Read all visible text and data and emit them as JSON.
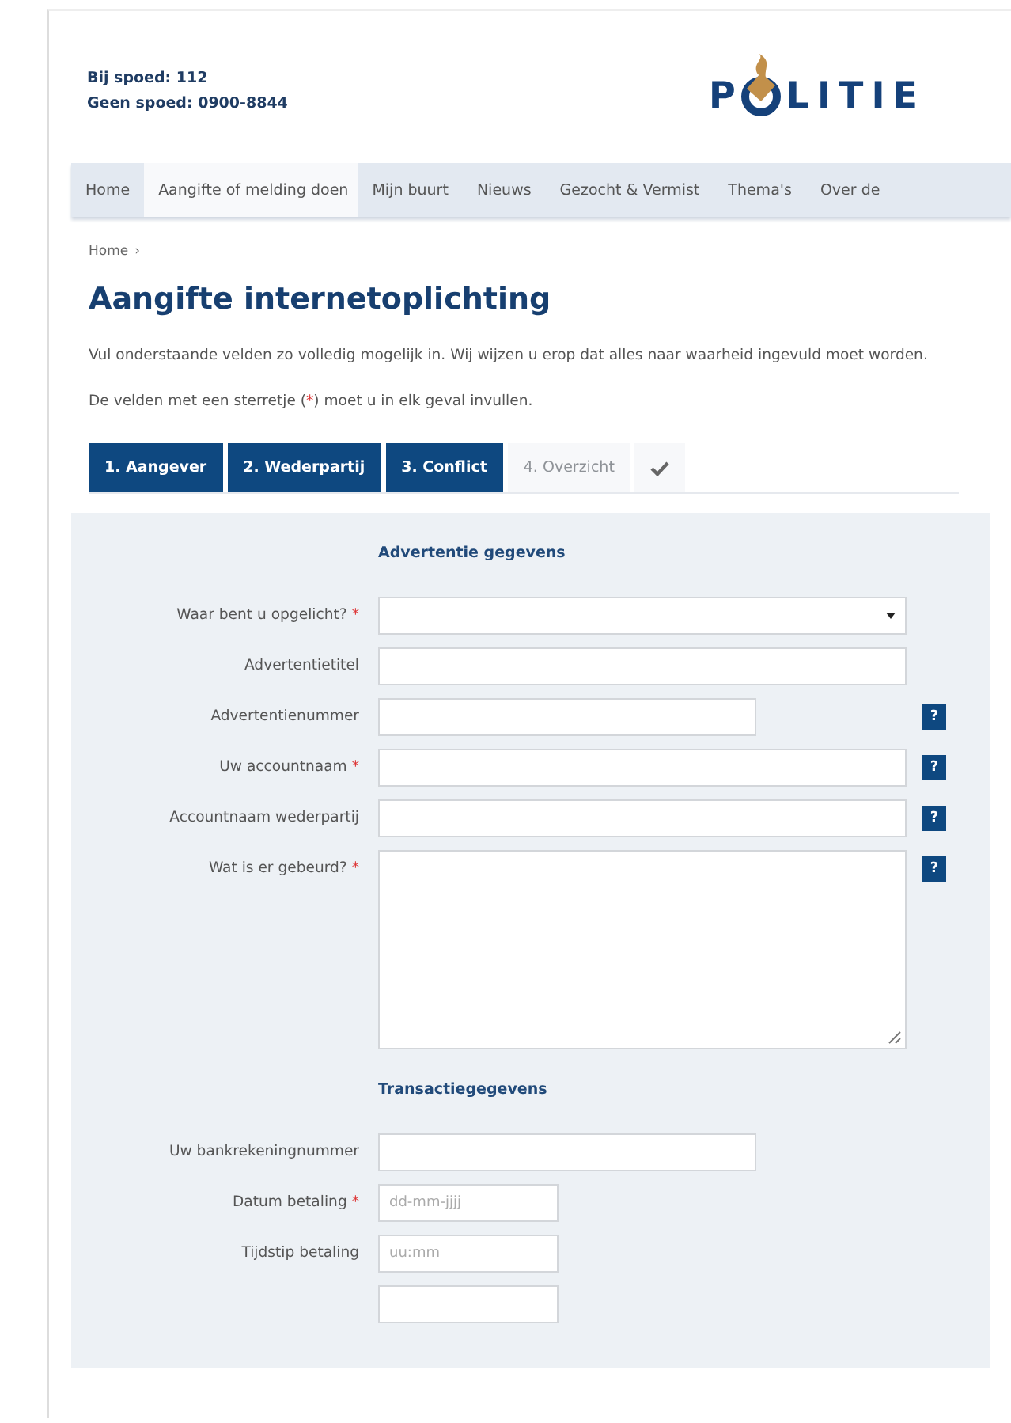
{
  "header": {
    "contact": [
      "Bij spoed: 112",
      "Geen spoed: 0900-8844"
    ],
    "logo": {
      "before": "P",
      "after": "LITIE"
    }
  },
  "nav": [
    {
      "label": "Home",
      "selected": false
    },
    {
      "label": "Aangifte of melding doen",
      "selected": true
    },
    {
      "label": "Mijn buurt",
      "selected": false
    },
    {
      "label": "Nieuws",
      "selected": false
    },
    {
      "label": "Gezocht & Vermist",
      "selected": false
    },
    {
      "label": "Thema's",
      "selected": false
    },
    {
      "label": "Over de",
      "selected": false
    }
  ],
  "breadcrumb": [
    {
      "label": "Home",
      "separator": "›"
    }
  ],
  "title": "Aangifte internetoplichting",
  "intro": "Vul onderstaande velden zo volledig mogelijk in. Wij wijzen u erop dat alles naar waarheid ingevuld moet worden.",
  "required_note": {
    "before": "De velden met een sterretje (",
    "mark": "*",
    "after": ") moet u in elk geval invullen."
  },
  "steps": [
    {
      "label": "1. Aangever",
      "completed": true
    },
    {
      "label": "2. Wederpartij",
      "completed": true
    },
    {
      "label": "3. Conflict",
      "completed": true
    },
    {
      "label": "4. Overzicht",
      "completed": false
    },
    {
      "kind": "finish",
      "completed": false
    }
  ],
  "sections": [
    {
      "title": "Advertentie gegevens",
      "fields": [
        {
          "label": "Waar bent u opgelicht?",
          "kind": "select",
          "required": true
        },
        {
          "label": "Advertentietitel",
          "kind": "wide",
          "required": false
        },
        {
          "label": "Advertentienummer",
          "kind": "medium",
          "required": false,
          "help": "?"
        },
        {
          "label": "Uw accountnaam",
          "kind": "wide",
          "required": true,
          "help": "?"
        },
        {
          "label": "Accountnaam wederpartij",
          "kind": "wide",
          "required": false,
          "help": "?"
        },
        {
          "label": "Wat is er gebeurd?",
          "kind": "textarea",
          "required": true,
          "help": "?"
        }
      ]
    },
    {
      "title": "Transactiegegevens",
      "fields": [
        {
          "label": "Uw bankrekeningnummer",
          "kind": "medium",
          "required": false
        },
        {
          "label": "Datum betaling",
          "kind": "short",
          "required": true,
          "placeholder": "dd-mm-jjjj"
        },
        {
          "label": "Tijdstip betaling",
          "kind": "short",
          "required": false,
          "placeholder": "uu:mm"
        },
        {
          "kind": "short",
          "required": false
        }
      ]
    }
  ]
}
